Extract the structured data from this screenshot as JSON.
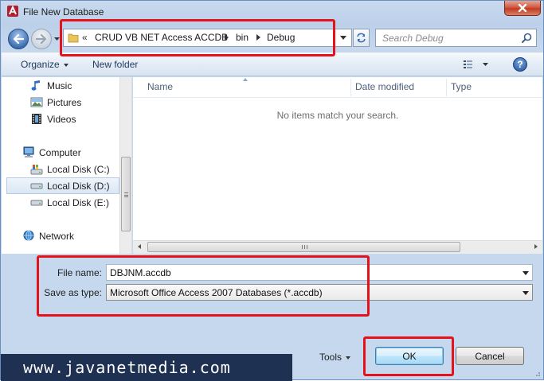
{
  "window": {
    "title": "File New Database"
  },
  "address": {
    "overflow": "«",
    "crumbs": [
      "CRUD VB NET Access ACCDB",
      "bin",
      "Debug"
    ]
  },
  "search": {
    "placeholder": "Search Debug"
  },
  "toolbar": {
    "organize": "Organize",
    "new_folder": "New folder",
    "help": "?"
  },
  "nav": {
    "items": [
      {
        "label": "Music",
        "icon": "music-icon"
      },
      {
        "label": "Pictures",
        "icon": "pictures-icon"
      },
      {
        "label": "Videos",
        "icon": "videos-icon"
      },
      {
        "label": "Computer",
        "icon": "computer-icon"
      },
      {
        "label": "Local Disk (C:)",
        "icon": "system-drive-icon"
      },
      {
        "label": "Local Disk (D:)",
        "icon": "drive-icon",
        "selected": true
      },
      {
        "label": "Local Disk (E:)",
        "icon": "drive-icon"
      },
      {
        "label": "Network",
        "icon": "network-icon"
      }
    ]
  },
  "files": {
    "columns": [
      "Name",
      "Date modified",
      "Type"
    ],
    "empty_message": "No items match your search."
  },
  "form": {
    "file_name_label": "File name:",
    "file_name_value": "DBJNM.accdb",
    "save_type_label": "Save as type:",
    "save_type_value": "Microsoft Office Access 2007 Databases (*.accdb)"
  },
  "buttons": {
    "tools": "Tools",
    "ok": "OK",
    "cancel": "Cancel"
  },
  "watermark": "www.javanetmedia.com",
  "colors": {
    "highlight": "#e3121b",
    "watermark_bg": "#1e3152"
  }
}
